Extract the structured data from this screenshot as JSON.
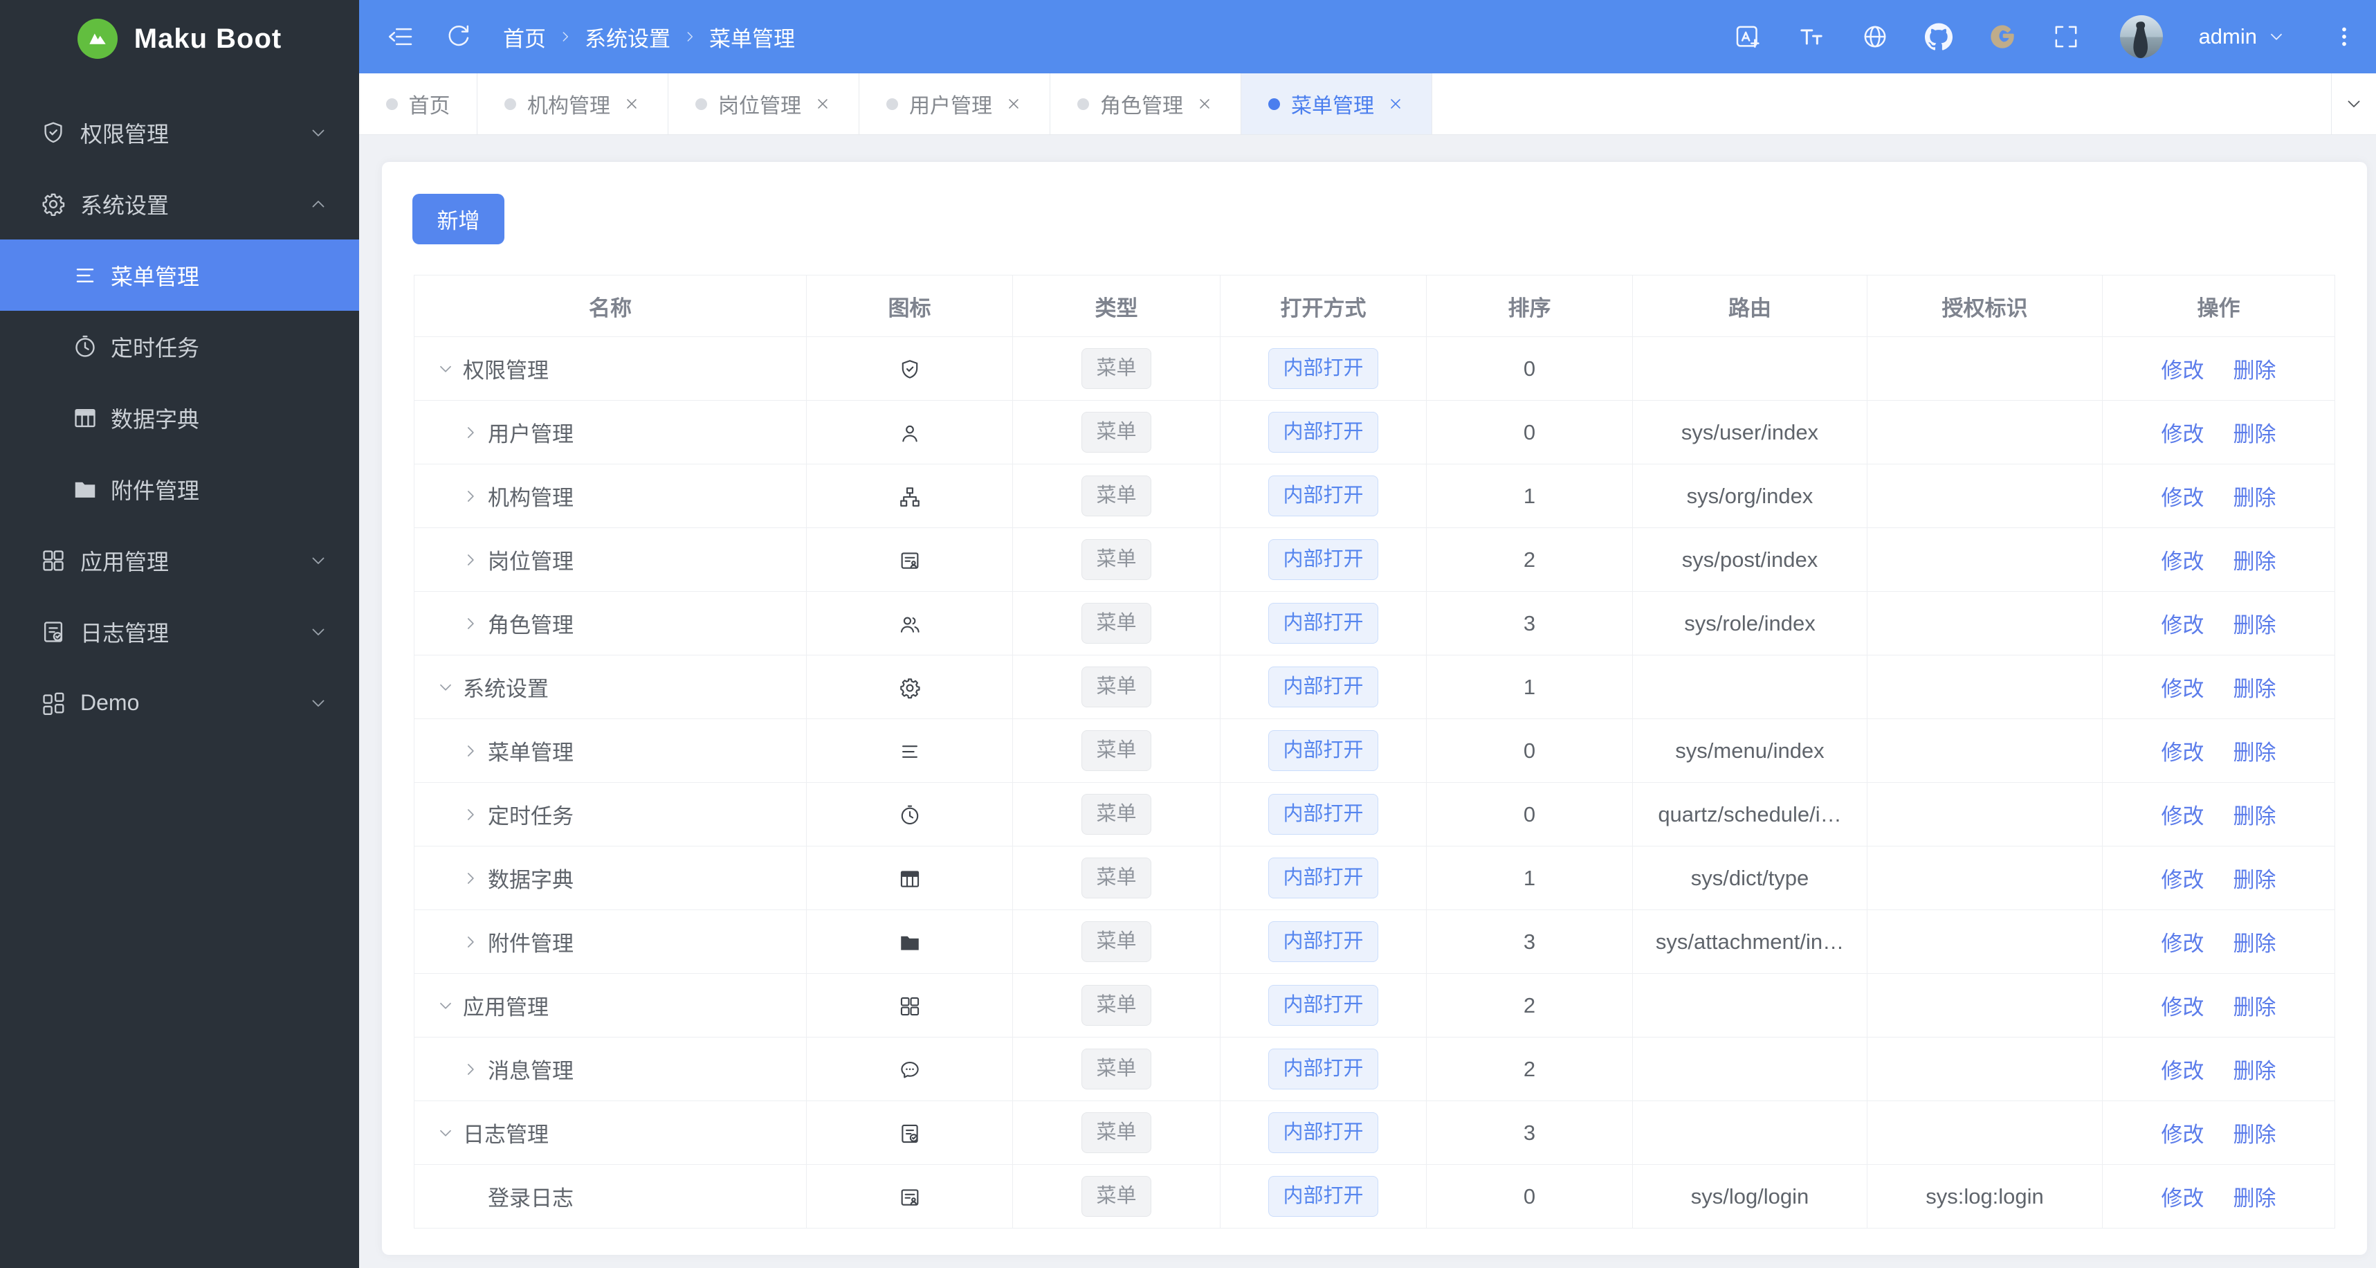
{
  "app": {
    "title": "Maku Boot",
    "logo_icon": "mountain-icon"
  },
  "sidebar": {
    "items": [
      {
        "label": "权限管理",
        "icon": "shield-check-icon",
        "type": "group",
        "chevron": "down"
      },
      {
        "label": "系统设置",
        "icon": "gear-icon",
        "type": "group",
        "chevron": "up",
        "expanded": true
      },
      {
        "label": "菜单管理",
        "icon": "menu-lines-icon",
        "type": "sub",
        "active": true
      },
      {
        "label": "定时任务",
        "icon": "clock-icon",
        "type": "sub"
      },
      {
        "label": "数据字典",
        "icon": "dict-table-icon",
        "type": "sub"
      },
      {
        "label": "附件管理",
        "icon": "folder-icon",
        "type": "sub"
      },
      {
        "label": "应用管理",
        "icon": "grid-icon",
        "type": "group",
        "chevron": "down"
      },
      {
        "label": "日志管理",
        "icon": "log-check-icon",
        "type": "group",
        "chevron": "down"
      },
      {
        "label": "Demo",
        "icon": "grid-offset-icon",
        "type": "group",
        "chevron": "down"
      }
    ]
  },
  "header": {
    "left_icons": [
      "menu-fold-icon",
      "refresh-icon"
    ],
    "breadcrumb": [
      "首页",
      "系统设置",
      "菜单管理"
    ],
    "actions": [
      "translate-icon",
      "font-size-icon",
      "globe-icon",
      "github-icon",
      "gitee-icon",
      "fullscreen-icon"
    ],
    "user": "admin",
    "user_menu_icon": "chevron-down-icon",
    "more_icon": "kebab-icon"
  },
  "tabs": [
    {
      "label": "首页",
      "closable": false,
      "active": false
    },
    {
      "label": "机构管理",
      "closable": true,
      "active": false
    },
    {
      "label": "岗位管理",
      "closable": true,
      "active": false
    },
    {
      "label": "用户管理",
      "closable": true,
      "active": false
    },
    {
      "label": "角色管理",
      "closable": true,
      "active": false
    },
    {
      "label": "菜单管理",
      "closable": true,
      "active": true
    }
  ],
  "toolbar": {
    "add_label": "新增"
  },
  "table": {
    "columns": [
      "名称",
      "图标",
      "类型",
      "打开方式",
      "排序",
      "路由",
      "授权标识",
      "操作"
    ],
    "type_label": "菜单",
    "open_label": "内部打开",
    "edit_label": "修改",
    "delete_label": "删除",
    "rows": [
      {
        "name": "权限管理",
        "icon": "shield-check-icon",
        "level": 0,
        "arrow": "down",
        "sort": "0",
        "route": "",
        "perm": ""
      },
      {
        "name": "用户管理",
        "icon": "user-icon",
        "level": 1,
        "arrow": "right",
        "sort": "0",
        "route": "sys/user/index",
        "perm": ""
      },
      {
        "name": "机构管理",
        "icon": "org-tree-icon",
        "level": 1,
        "arrow": "right",
        "sort": "1",
        "route": "sys/org/index",
        "perm": ""
      },
      {
        "name": "岗位管理",
        "icon": "badge-icon",
        "level": 1,
        "arrow": "right",
        "sort": "2",
        "route": "sys/post/index",
        "perm": ""
      },
      {
        "name": "角色管理",
        "icon": "users-icon",
        "level": 1,
        "arrow": "right",
        "sort": "3",
        "route": "sys/role/index",
        "perm": ""
      },
      {
        "name": "系统设置",
        "icon": "gear-icon",
        "level": 0,
        "arrow": "down",
        "sort": "1",
        "route": "",
        "perm": ""
      },
      {
        "name": "菜单管理",
        "icon": "menu-lines-icon",
        "level": 1,
        "arrow": "right",
        "sort": "0",
        "route": "sys/menu/index",
        "perm": ""
      },
      {
        "name": "定时任务",
        "icon": "clock-icon",
        "level": 1,
        "arrow": "right",
        "sort": "0",
        "route": "quartz/schedule/i…",
        "perm": ""
      },
      {
        "name": "数据字典",
        "icon": "dict-table-icon",
        "level": 1,
        "arrow": "right",
        "sort": "1",
        "route": "sys/dict/type",
        "perm": ""
      },
      {
        "name": "附件管理",
        "icon": "folder-icon",
        "level": 1,
        "arrow": "right",
        "sort": "3",
        "route": "sys/attachment/in…",
        "perm": ""
      },
      {
        "name": "应用管理",
        "icon": "grid-icon",
        "level": 0,
        "arrow": "down",
        "sort": "2",
        "route": "",
        "perm": ""
      },
      {
        "name": "消息管理",
        "icon": "chat-icon",
        "level": 1,
        "arrow": "right",
        "sort": "2",
        "route": "",
        "perm": ""
      },
      {
        "name": "日志管理",
        "icon": "log-check-icon",
        "level": 0,
        "arrow": "down",
        "sort": "3",
        "route": "",
        "perm": ""
      },
      {
        "name": "登录日志",
        "icon": "badge-icon",
        "level": 1,
        "arrow": "none",
        "sort": "0",
        "route": "sys/log/login",
        "perm": "sys:log:login"
      }
    ]
  },
  "colors": {
    "primary": "#5585EE",
    "header_bg": "#538CEE",
    "sidebar_bg": "#2A3139",
    "sidebar_active_bg": "#5585EE",
    "content_bg": "#EFF1F5",
    "active_tab_bg": "#EAF0FB",
    "link": "#5B7CEA",
    "logo_green": "#62BE3F",
    "tag_menu_text": "#8F949C",
    "tag_open_text": "#5585EE",
    "table_border": "#EDEFF2"
  }
}
